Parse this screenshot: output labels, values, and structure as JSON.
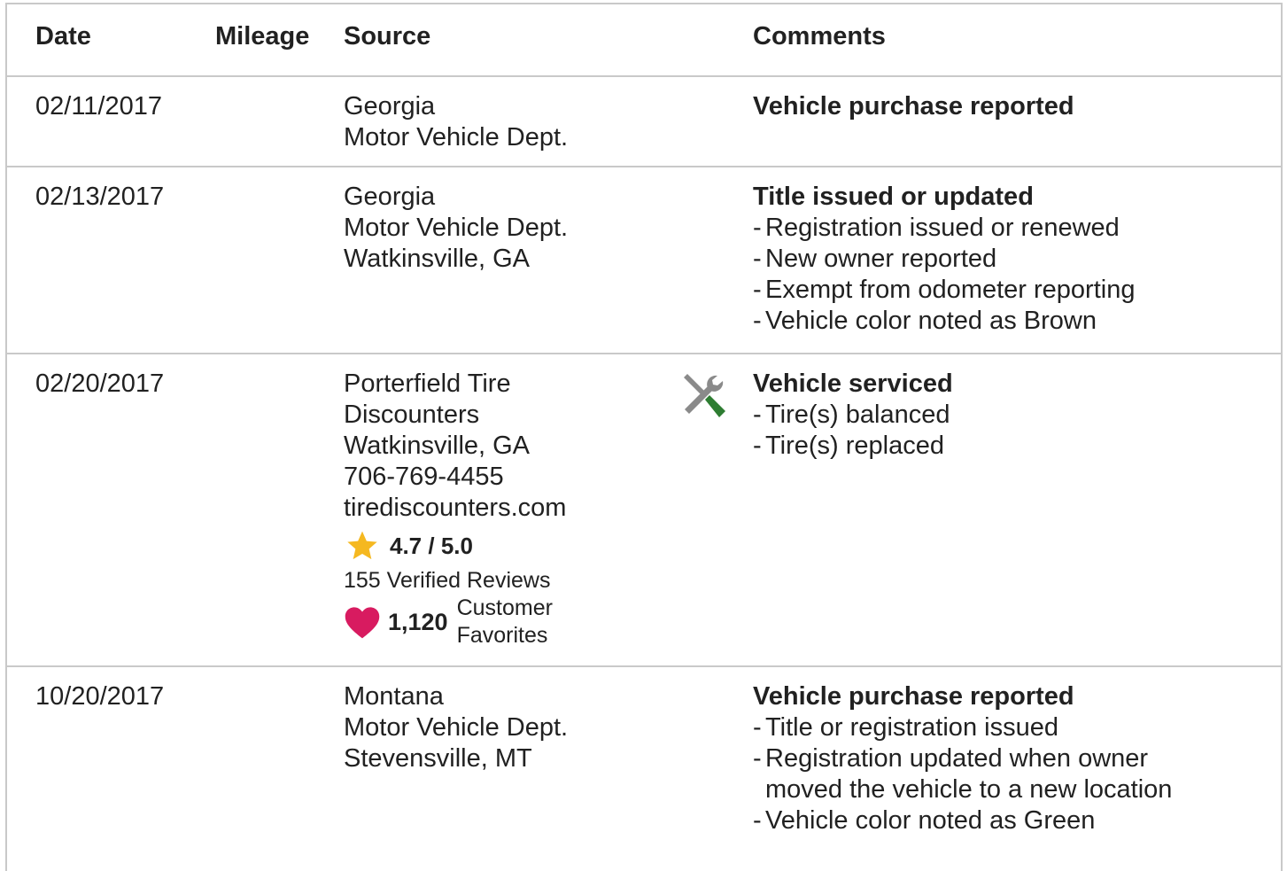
{
  "header": {
    "date": "Date",
    "mileage": "Mileage",
    "source": "Source",
    "comments": "Comments"
  },
  "rows": [
    {
      "date": "02/11/2017",
      "source": [
        "Georgia",
        "Motor Vehicle Dept."
      ],
      "comment_title": "Vehicle purchase reported",
      "comment_items": []
    },
    {
      "date": "02/13/2017",
      "source": [
        "Georgia",
        "Motor Vehicle Dept.",
        "Watkinsville, GA"
      ],
      "comment_title": "Title issued or updated",
      "comment_items": [
        "Registration issued or renewed",
        "New owner reported",
        "Exempt from odometer reporting",
        "Vehicle color noted as Brown"
      ]
    },
    {
      "date": "02/20/2017",
      "source": [
        "Porterfield Tire",
        "Discounters",
        "Watkinsville, GA",
        "706-769-4455",
        "tirediscounters.com"
      ],
      "rating": "4.7 / 5.0",
      "reviews": "155 Verified Reviews",
      "favorites_count": "1,120",
      "favorites_label_1": "Customer",
      "favorites_label_2": "Favorites",
      "icon": "service-tools-icon",
      "comment_title": "Vehicle serviced",
      "comment_items": [
        "Tire(s) balanced",
        "Tire(s) replaced"
      ]
    },
    {
      "date": "10/20/2017",
      "source": [
        "Montana",
        "Motor Vehicle Dept.",
        "Stevensville, MT"
      ],
      "comment_title": "Vehicle purchase reported",
      "comment_items": [
        "Title or registration issued",
        "Registration updated when owner",
        "moved the vehicle to a new location",
        "Vehicle color noted as Green"
      ]
    }
  ],
  "colors": {
    "border": "#c9c9c9",
    "star": "#f5b820",
    "heart": "#d81b60",
    "tool_green": "#2e7d32",
    "tool_gray": "#8a8a8a"
  }
}
